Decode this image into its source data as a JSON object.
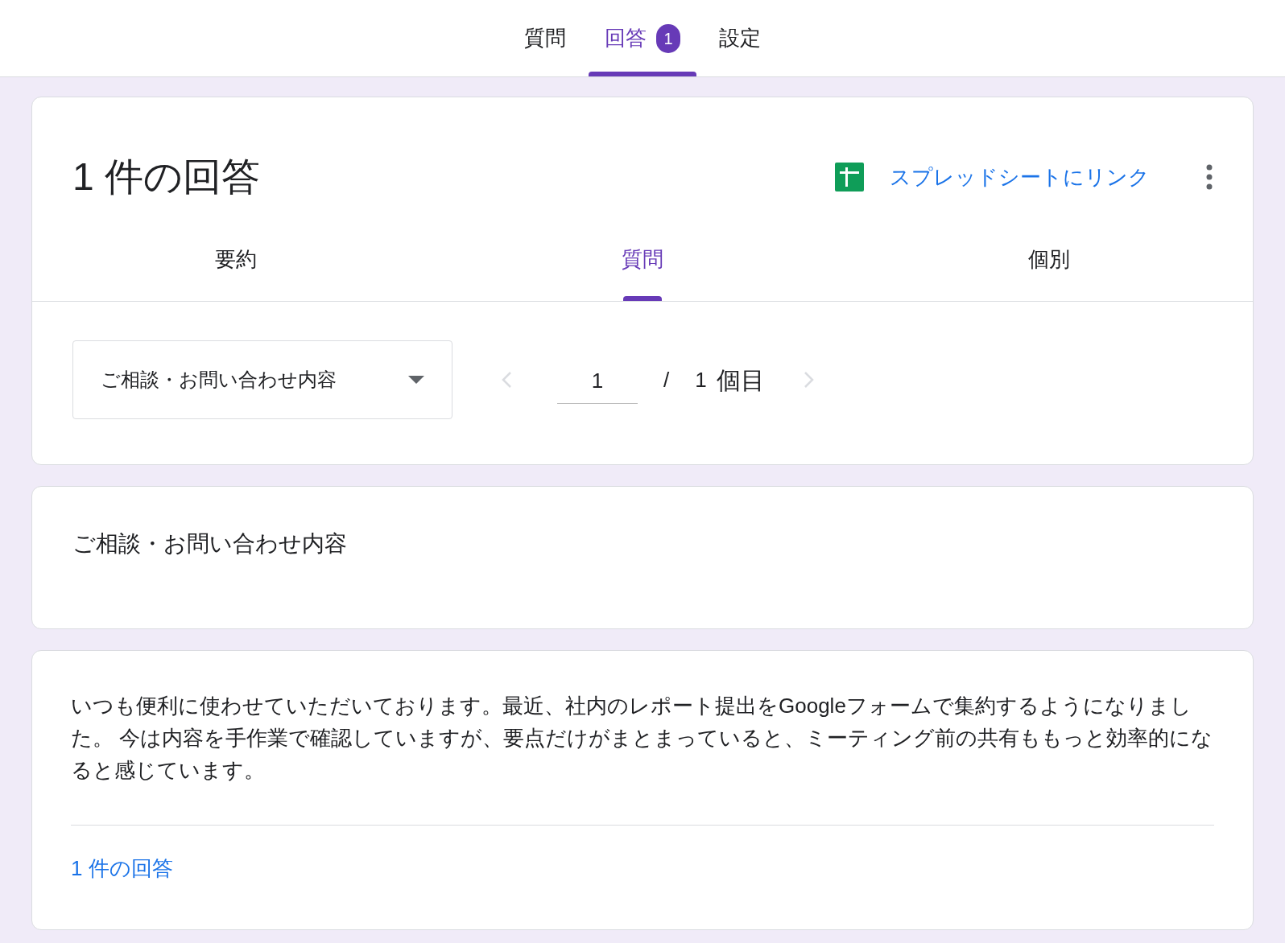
{
  "top_tabs": [
    {
      "label": "質問",
      "selected": false
    },
    {
      "label": "回答",
      "selected": true,
      "badge": "1"
    },
    {
      "label": "設定",
      "selected": false
    }
  ],
  "summary": {
    "title": "1 件の回答",
    "sheet_link": "スプレッドシートにリンク",
    "tabs": [
      {
        "label": "要約",
        "selected": false
      },
      {
        "label": "質問",
        "selected": true
      },
      {
        "label": "個別",
        "selected": false
      }
    ]
  },
  "question_picker": {
    "value": "ご相談・お問い合わせ内容"
  },
  "pager": {
    "current": "1",
    "separator": "/",
    "total": "1",
    "unit": "個目"
  },
  "question_card": {
    "title": "ご相談・お問い合わせ内容"
  },
  "answer_card": {
    "answer": "いつも便利に使わせていただいております。最近、社内のレポート提出をGoogleフォームで集約するようになりました。 今は内容を手作業で確認していますが、要点だけがまとまっていると、ミーティング前の共有ももっと効率的になると感じています。",
    "count_link": "1 件の回答"
  }
}
